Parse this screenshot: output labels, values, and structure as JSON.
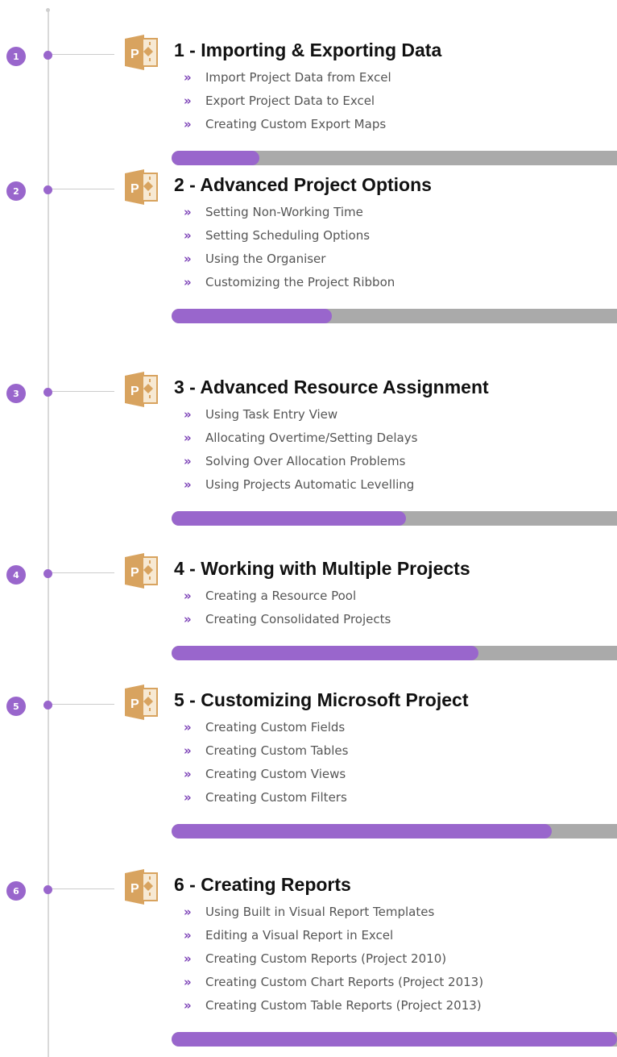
{
  "modules": [
    {
      "number": "1",
      "title": "1 - Importing & Exporting Data",
      "lessons": [
        "Import Project Data from Excel",
        "Export Project Data to Excel",
        "Creating Custom Export Maps"
      ],
      "progress": 0.197
    },
    {
      "number": "2",
      "title": "2 - Advanced Project Options",
      "lessons": [
        "Setting Non-Working Time",
        "Setting Scheduling Options",
        "Using the Organiser",
        "Customizing the Project Ribbon"
      ],
      "progress": 0.36
    },
    {
      "number": "3",
      "title": "3 - Advanced Resource Assignment",
      "lessons": [
        "Using Task Entry View",
        "Allocating Overtime/Setting Delays",
        "Solving Over Allocation Problems",
        "Using Projects Automatic Levelling"
      ],
      "progress": 0.526
    },
    {
      "number": "4",
      "title": "4 - Working with Multiple Projects",
      "lessons": [
        "Creating a Resource Pool",
        "Creating Consolidated Projects"
      ],
      "progress": 0.689
    },
    {
      "number": "5",
      "title": "5 - Customizing Microsoft Project",
      "lessons": [
        "Creating Custom Fields",
        "Creating Custom Tables",
        "Creating Custom Views",
        "Creating Custom Filters"
      ],
      "progress": 0.853
    },
    {
      "number": "6",
      "title": "6 - Creating Reports",
      "lessons": [
        "Using Built in Visual Report Templates",
        "Editing a Visual Report in Excel",
        "Creating Custom Reports (Project 2010)",
        "Creating Custom Chart Reports (Project 2013)",
        "Creating Custom Table Reports (Project 2013)"
      ],
      "progress": 1.0
    }
  ],
  "lesson_bullet": "»",
  "icon": {
    "name": "microsoft-project-icon",
    "letter": "P",
    "color": "#d8a35f"
  },
  "colors": {
    "accent": "#9966cc",
    "track": "#aaaaaa",
    "title": "#111111",
    "lesson_text": "#555555"
  }
}
